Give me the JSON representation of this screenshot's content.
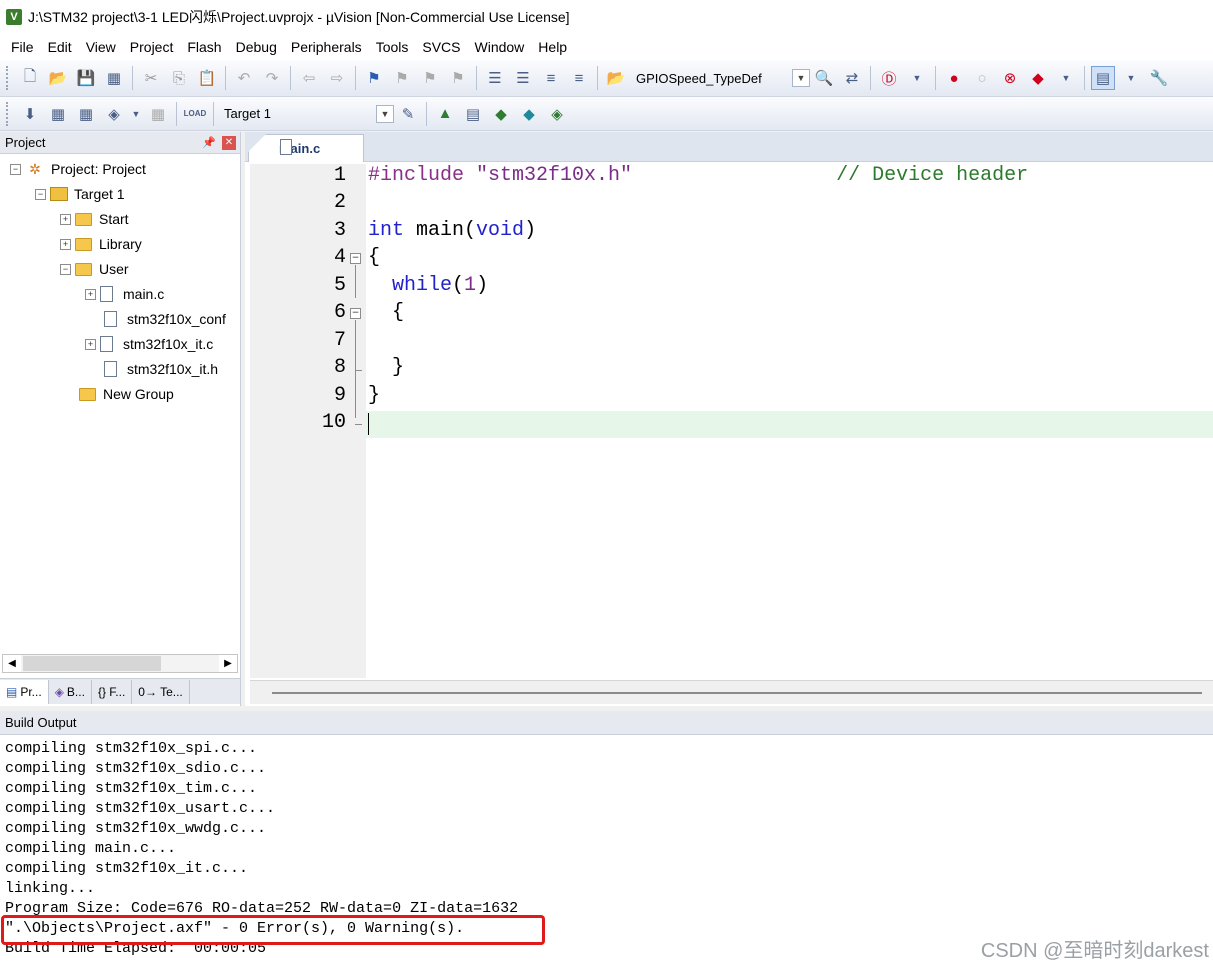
{
  "window": {
    "title": "J:\\STM32 project\\3-1 LED闪烁\\Project.uvprojx - µVision  [Non-Commercial Use License]",
    "icon_label": "V"
  },
  "menu": [
    {
      "label": "File"
    },
    {
      "label": "Edit"
    },
    {
      "label": "View"
    },
    {
      "label": "Project"
    },
    {
      "label": "Flash"
    },
    {
      "label": "Debug"
    },
    {
      "label": "Peripherals"
    },
    {
      "label": "Tools"
    },
    {
      "label": "SVCS"
    },
    {
      "label": "Window"
    },
    {
      "label": "Help"
    }
  ],
  "toolbar": {
    "find_combo_value": "GPIOSpeed_TypeDef",
    "target_combo_value": "Target 1",
    "load_label": "LOAD"
  },
  "project_panel": {
    "title": "Project",
    "tree": [
      {
        "label": "Project: Project"
      },
      {
        "label": "Target 1"
      },
      {
        "label": "Start"
      },
      {
        "label": "Library"
      },
      {
        "label": "User"
      },
      {
        "label": "main.c"
      },
      {
        "label": "stm32f10x_conf"
      },
      {
        "label": "stm32f10x_it.c"
      },
      {
        "label": "stm32f10x_it.h"
      },
      {
        "label": "New Group"
      }
    ],
    "tabs": [
      {
        "label": "Pr..."
      },
      {
        "label": "B..."
      },
      {
        "label": "{} F..."
      },
      {
        "label": "0→ Te..."
      }
    ]
  },
  "editor": {
    "tab_label": "main.c",
    "lines": [
      {
        "n": "1"
      },
      {
        "n": "2"
      },
      {
        "n": "3"
      },
      {
        "n": "4"
      },
      {
        "n": "5"
      },
      {
        "n": "6"
      },
      {
        "n": "7"
      },
      {
        "n": "8"
      },
      {
        "n": "9"
      },
      {
        "n": "10"
      }
    ],
    "code": {
      "l1_pre": "#include",
      "l1_str": "\"stm32f10x.h\"",
      "l1_cmt": "// Device header",
      "l3_kw1": "int",
      "l3_name": "main(",
      "l3_kw2": "void",
      "l3_close": ")",
      "l4": "{",
      "l5_kw": "while",
      "l5_open": "(",
      "l5_num": "1",
      "l5_close": ")",
      "l6": "{",
      "l8": "}",
      "l9": "}"
    }
  },
  "build_output": {
    "title": "Build Output",
    "lines": [
      "compiling stm32f10x_spi.c...",
      "compiling stm32f10x_sdio.c...",
      "compiling stm32f10x_tim.c...",
      "compiling stm32f10x_usart.c...",
      "compiling stm32f10x_wwdg.c...",
      "compiling main.c...",
      "compiling stm32f10x_it.c...",
      "linking...",
      "Program Size: Code=676 RO-data=252 RW-data=0 ZI-data=1632",
      "\".\\Objects\\Project.axf\" - 0 Error(s), 0 Warning(s).",
      "Build Time Elapsed:  00:00:05"
    ]
  },
  "watermark": "CSDN @至暗时刻darkest",
  "colors": {
    "highlight_box": "#e0191b",
    "current_line": "#e6f6e9"
  }
}
